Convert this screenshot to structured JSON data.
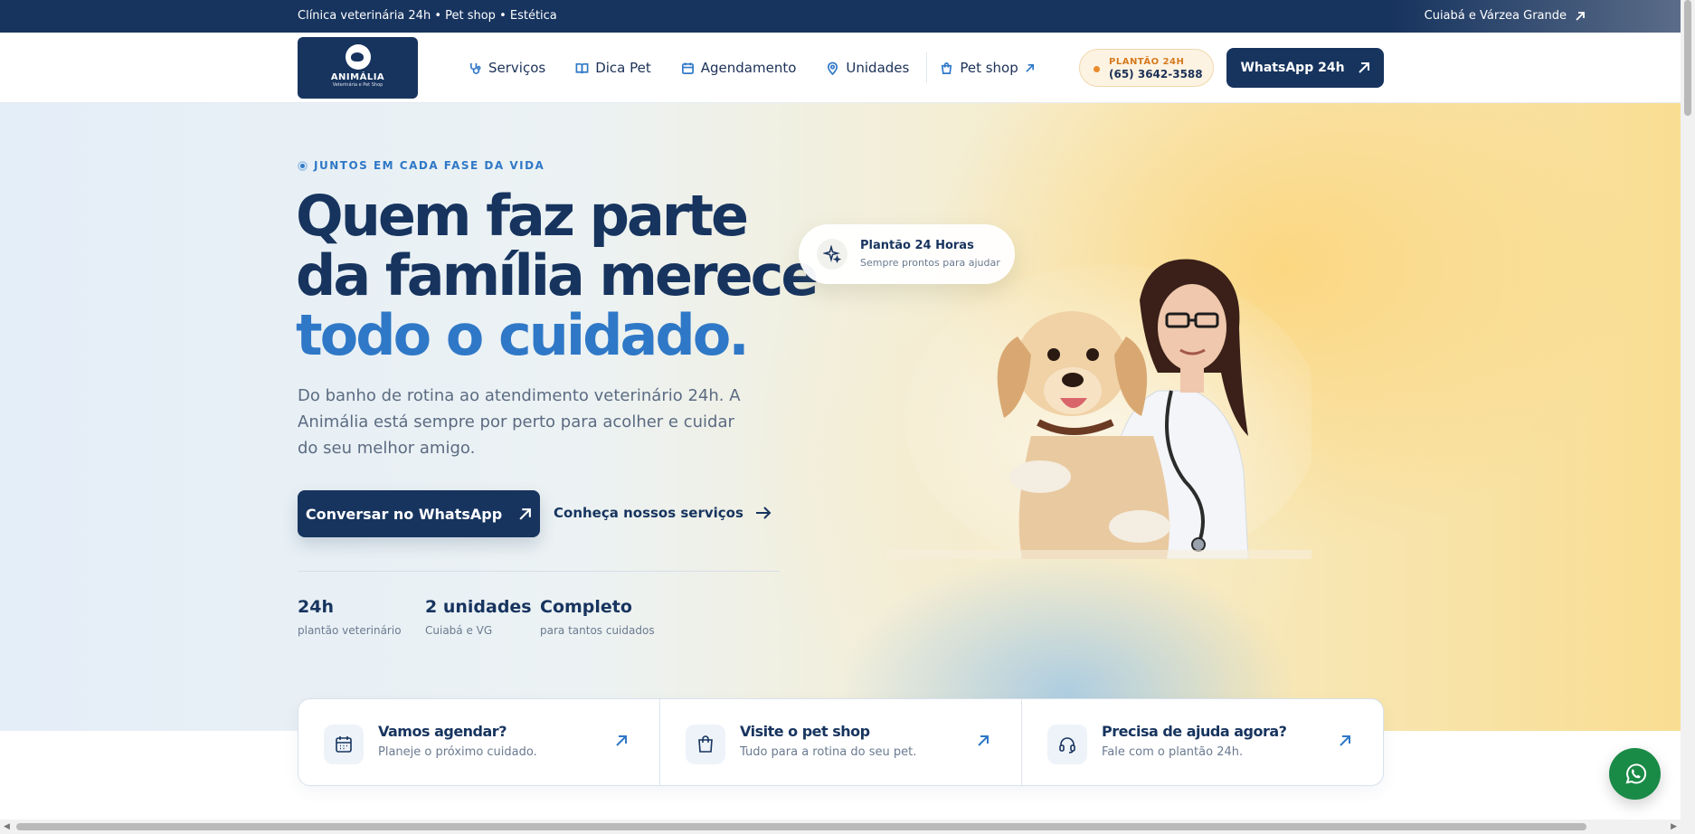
{
  "topbar": {
    "tagline": "Clínica veterinária 24h • Pet shop • Estética",
    "location": "Cuiabá e Várzea Grande",
    "location_icon": "arrow-up-right-icon"
  },
  "header": {
    "logo": {
      "name": "ANIMÁLIA",
      "subtitle": "Veterinária e Pet Shop"
    },
    "nav": [
      {
        "label": "Serviços",
        "icon": "stethoscope-icon"
      },
      {
        "label": "Dica Pet",
        "icon": "book-icon"
      },
      {
        "label": "Agendamento",
        "icon": "calendar-icon"
      },
      {
        "label": "Unidades",
        "icon": "map-pin-icon"
      },
      {
        "label": "Pet shop",
        "icon": "shopping-bag-icon"
      }
    ],
    "plantao": {
      "label": "PLANTÃO 24H",
      "phone": "(65) 3642-3588"
    },
    "whatsapp_button": "WhatsApp 24h"
  },
  "hero": {
    "eyebrow": "JUNTOS EM CADA FASE DA VIDA",
    "headline_line1": "Quem faz parte",
    "headline_line2": "da família merece",
    "headline_line3": "todo o cuidado.",
    "lead": "Do banho de rotina ao atendimento veterinário 24h. A Animália está sempre por perto para acolher e cuidar do seu melhor amigo.",
    "cta_primary": "Conversar no WhatsApp",
    "cta_secondary": "Conheça nossos serviços",
    "stats": [
      {
        "value": "24h",
        "label": "plantão veterinário"
      },
      {
        "value": "2 unidades",
        "label": "Cuiabá e VG"
      },
      {
        "value": "Completo",
        "label": "para tantos cuidados"
      }
    ],
    "badge": {
      "title": "Plantão 24 Horas",
      "subtitle": "Sempre prontos para ajudar",
      "icon": "sparkles-icon"
    }
  },
  "quick_actions": [
    {
      "title": "Vamos agendar?",
      "subtitle": "Planeje o próximo cuidado.",
      "icon": "calendar-icon"
    },
    {
      "title": "Visite o pet shop",
      "subtitle": "Tudo para a rotina do seu pet.",
      "icon": "shopping-bag-icon"
    },
    {
      "title": "Precisa de ajuda agora?",
      "subtitle": "Fale com o plantão 24h.",
      "icon": "headset-icon"
    }
  ],
  "colors": {
    "navy": "#17345f",
    "accent_blue": "#2f78c7",
    "whatsapp_green": "#1a8a47",
    "plantao_orange": "#ea8b2b"
  }
}
